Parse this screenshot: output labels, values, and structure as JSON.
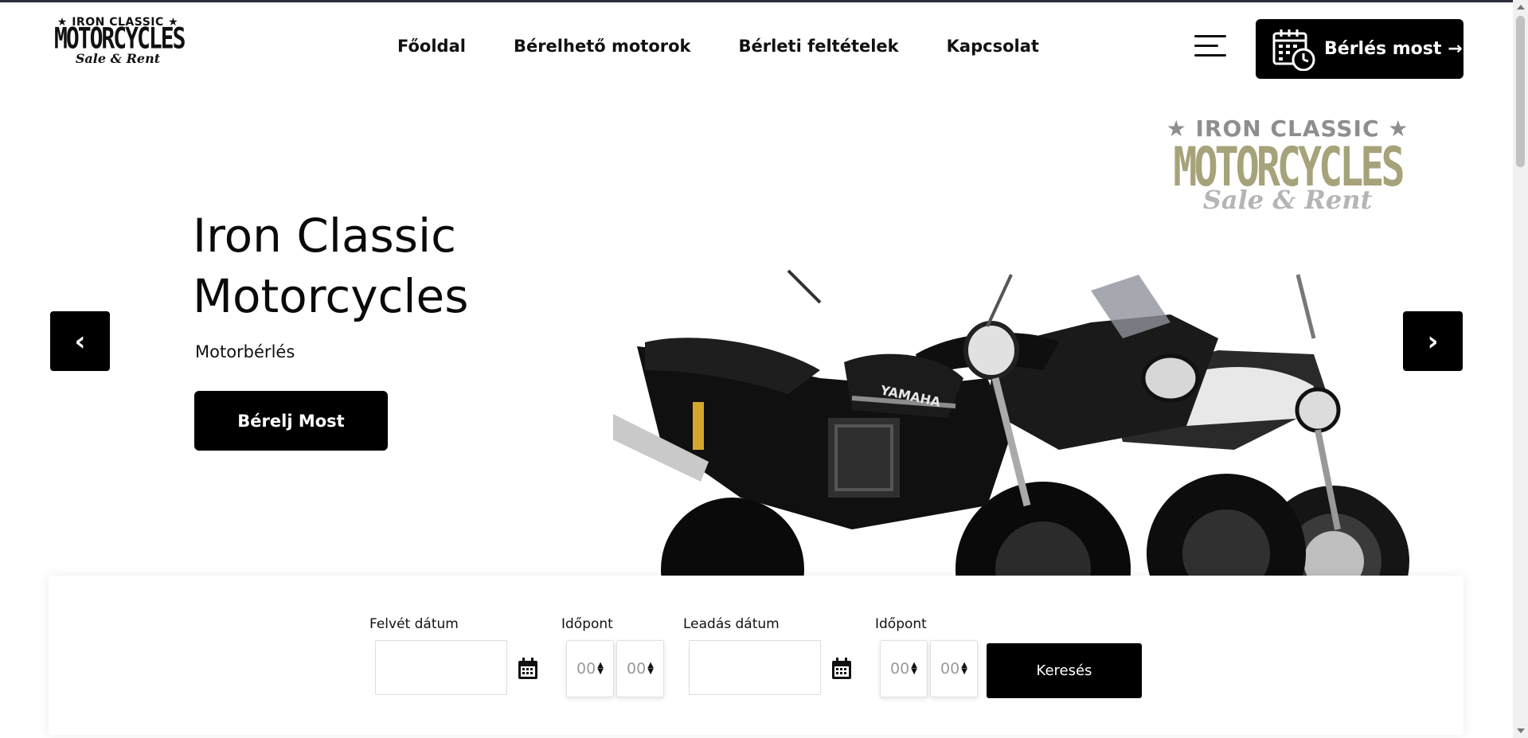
{
  "brand": {
    "logo_line1": "★ IRON CLASSIC ★",
    "logo_line2": "MOTORCYCLES",
    "logo_line3": "Sale & Rent"
  },
  "nav": {
    "items": [
      {
        "label": "Főoldal"
      },
      {
        "label": "Bérelhető motorok"
      },
      {
        "label": "Bérleti feltételek"
      },
      {
        "label": "Kapcsolat"
      }
    ]
  },
  "header": {
    "menu_icon": "hamburger-menu-icon",
    "rent_button_label": "Bérlés most →",
    "rent_button_icon": "calendar-clock-icon"
  },
  "hero": {
    "title": "Iron Classic Motorcycles",
    "subtitle": "Motorbérlés",
    "cta_label": "Bérelj Most",
    "prev_symbol": "‹",
    "next_symbol": "›",
    "badge_line1": "★ IRON CLASSIC ★",
    "badge_line2": "MOTORCYCLES",
    "badge_line3": "Sale & Rent",
    "image_label": "YAMAHA"
  },
  "search": {
    "pickup_date_label": "Felvét dátum",
    "pickup_time_label": "Időpont",
    "return_date_label": "Leadás dátum",
    "return_time_label": "Időpont",
    "pickup_hour": "00",
    "pickup_minute": "00",
    "return_hour": "00",
    "return_minute": "00",
    "pickup_date_value": "",
    "return_date_value": "",
    "search_button_label": "Keresés",
    "calendar_icon": "calendar-icon"
  },
  "colors": {
    "primary": "#000000",
    "text": "#111111",
    "badge_gold": "#a6a27a",
    "badge_silver": "#8e8e8e"
  }
}
